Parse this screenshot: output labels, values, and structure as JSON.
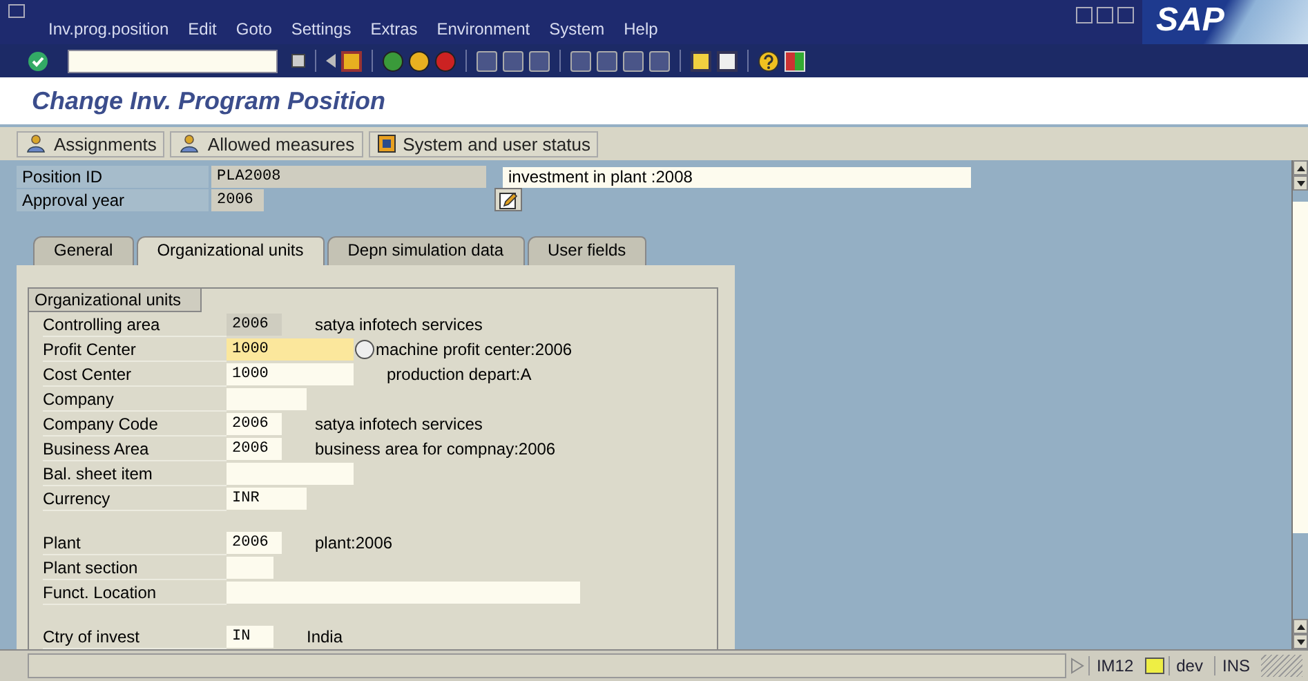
{
  "menu_bar": {
    "items": [
      "Inv.prog.position",
      "Edit",
      "Goto",
      "Settings",
      "Extras",
      "Environment",
      "System",
      "Help"
    ],
    "logo": "SAP"
  },
  "screen_title": "Change Inv. Program Position",
  "app_toolbar": [
    {
      "label": "Assignments"
    },
    {
      "label": "Allowed measures"
    },
    {
      "label": "System and user status"
    }
  ],
  "header": {
    "position_id": {
      "label": "Position ID",
      "value": "PLA2008",
      "description": "investment in plant :2008"
    },
    "approval_year": {
      "label": "Approval year",
      "value": "2006"
    }
  },
  "tabs": [
    {
      "label": "General",
      "selected": false
    },
    {
      "label": "Organizational units",
      "selected": true
    },
    {
      "label": "Depn simulation data",
      "selected": false
    },
    {
      "label": "User fields",
      "selected": false
    }
  ],
  "group_title": "Organizational units",
  "field_blocks": [
    [
      {
        "label": "Controlling area",
        "value": "2006",
        "readonly": true,
        "focused": false,
        "search_help": false,
        "description": "satya infotech  services"
      },
      {
        "label": "Profit Center",
        "value": "1000",
        "readonly": false,
        "focused": true,
        "search_help": true,
        "description": "machine profit center:2006"
      },
      {
        "label": "Cost Center",
        "value": "1000",
        "readonly": false,
        "focused": false,
        "search_help": false,
        "description": "production depart:A"
      },
      {
        "label": "Company",
        "readonly": false,
        "focused": false,
        "search_help": false
      },
      {
        "label": "Company Code",
        "value": "2006",
        "readonly": false,
        "focused": false,
        "search_help": false,
        "description": "satya infotech  services"
      },
      {
        "label": "Business Area",
        "value": "2006",
        "readonly": false,
        "focused": false,
        "search_help": false,
        "description": "business area for compnay:2006"
      },
      {
        "label": "Bal. sheet item",
        "readonly": false,
        "focused": false,
        "search_help": false
      },
      {
        "label": "Currency",
        "value": "INR",
        "readonly": false,
        "focused": false,
        "search_help": false
      }
    ],
    [
      {
        "label": "Plant",
        "value": "2006",
        "readonly": false,
        "focused": false,
        "search_help": false,
        "description": "plant:2006"
      },
      {
        "label": "Plant section",
        "readonly": false,
        "focused": false,
        "search_help": false
      },
      {
        "label": "Funct. Location",
        "readonly": false,
        "focused": false,
        "search_help": false
      }
    ],
    [
      {
        "label": "Ctry of invest",
        "value": "IN",
        "readonly": false,
        "focused": false,
        "search_help": false,
        "description": "India"
      }
    ]
  ],
  "status_bar": {
    "transaction": "IM12",
    "system": "dev",
    "mode": "INS"
  }
}
